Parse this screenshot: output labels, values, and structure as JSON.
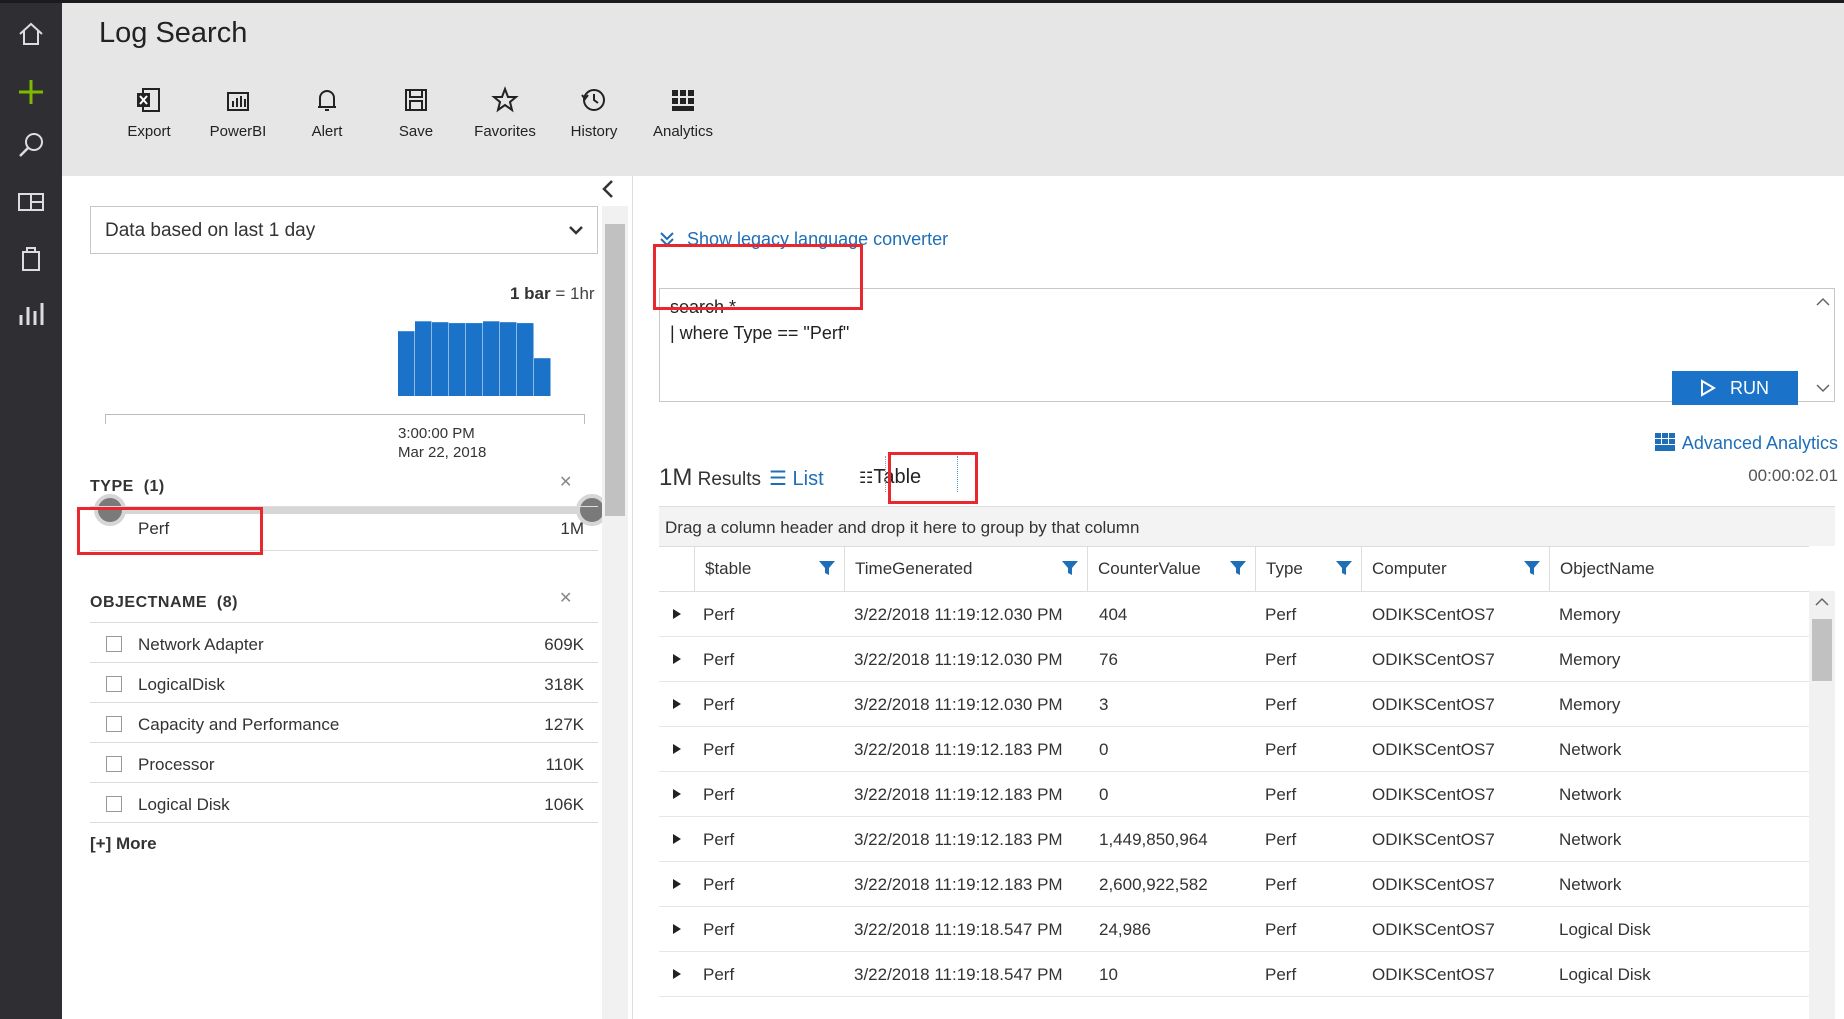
{
  "rail": {
    "icons": [
      "home-icon",
      "plus-icon",
      "search-icon",
      "dashboard-icon",
      "marketplace-icon",
      "chart-icon"
    ]
  },
  "header": {
    "title": "Log Search",
    "toolbar": [
      {
        "label": "Export",
        "icon": "excel-icon"
      },
      {
        "label": "PowerBI",
        "icon": "powerbi-icon"
      },
      {
        "label": "Alert",
        "icon": "bell-icon"
      },
      {
        "label": "Save",
        "icon": "save-icon"
      },
      {
        "label": "Favorites",
        "icon": "star-icon"
      },
      {
        "label": "History",
        "icon": "history-icon"
      },
      {
        "label": "Analytics",
        "icon": "analytics-icon"
      }
    ]
  },
  "left": {
    "time_range": "Data based on last 1 day",
    "bar_scale_strong": "1 bar",
    "bar_scale_rest": " = 1hr",
    "histogram": {
      "values": [
        0.72,
        0.83,
        0.82,
        0.81,
        0.81,
        0.83,
        0.82,
        0.81,
        0.42
      ],
      "color": "#1a73c8"
    },
    "tick_time": "3:00:00 PM",
    "tick_date": "Mar 22, 2018",
    "type_facet": {
      "title": "TYPE",
      "count": "(1)",
      "items": [
        {
          "label": "Perf",
          "count": "1M"
        }
      ]
    },
    "objectname_facet": {
      "title": "OBJECTNAME",
      "count": "(8)",
      "items": [
        {
          "label": "Network Adapter",
          "count": "609K"
        },
        {
          "label": "LogicalDisk",
          "count": "318K"
        },
        {
          "label": "Capacity and Performance",
          "count": "127K"
        },
        {
          "label": "Processor",
          "count": "110K"
        },
        {
          "label": "Logical Disk",
          "count": "106K"
        }
      ]
    },
    "more": "[+] More"
  },
  "right": {
    "legacy_link": "Show legacy language converter",
    "query_line1": "search *",
    "query_line2": "| where Type == \"Perf\"",
    "run_label": "RUN",
    "advanced": "Advanced Analytics",
    "results_num": "1M",
    "results_label": " Results",
    "list_tab": "List",
    "table_tab": "Table",
    "elapsed": "00:00:02.01",
    "group_hint": "Drag a column header and drop it here to group by that column",
    "columns": [
      "$table",
      "TimeGenerated",
      "CounterValue",
      "Type",
      "Computer",
      "ObjectName"
    ],
    "rows": [
      [
        "Perf",
        "3/22/2018 11:19:12.030 PM",
        "404",
        "Perf",
        "ODIKSCentOS7",
        "Memory"
      ],
      [
        "Perf",
        "3/22/2018 11:19:12.030 PM",
        "76",
        "Perf",
        "ODIKSCentOS7",
        "Memory"
      ],
      [
        "Perf",
        "3/22/2018 11:19:12.030 PM",
        "3",
        "Perf",
        "ODIKSCentOS7",
        "Memory"
      ],
      [
        "Perf",
        "3/22/2018 11:19:12.183 PM",
        "0",
        "Perf",
        "ODIKSCentOS7",
        "Network"
      ],
      [
        "Perf",
        "3/22/2018 11:19:12.183 PM",
        "0",
        "Perf",
        "ODIKSCentOS7",
        "Network"
      ],
      [
        "Perf",
        "3/22/2018 11:19:12.183 PM",
        "1,449,850,964",
        "Perf",
        "ODIKSCentOS7",
        "Network"
      ],
      [
        "Perf",
        "3/22/2018 11:19:12.183 PM",
        "2,600,922,582",
        "Perf",
        "ODIKSCentOS7",
        "Network"
      ],
      [
        "Perf",
        "3/22/2018 11:19:18.547 PM",
        "24,986",
        "Perf",
        "ODIKSCentOS7",
        "Logical Disk"
      ],
      [
        "Perf",
        "3/22/2018 11:19:18.547 PM",
        "10",
        "Perf",
        "ODIKSCentOS7",
        "Logical Disk"
      ]
    ]
  },
  "colors": {
    "accent": "#1a73c8",
    "highlight": "#e8272e",
    "rail": "#2e2e33"
  }
}
